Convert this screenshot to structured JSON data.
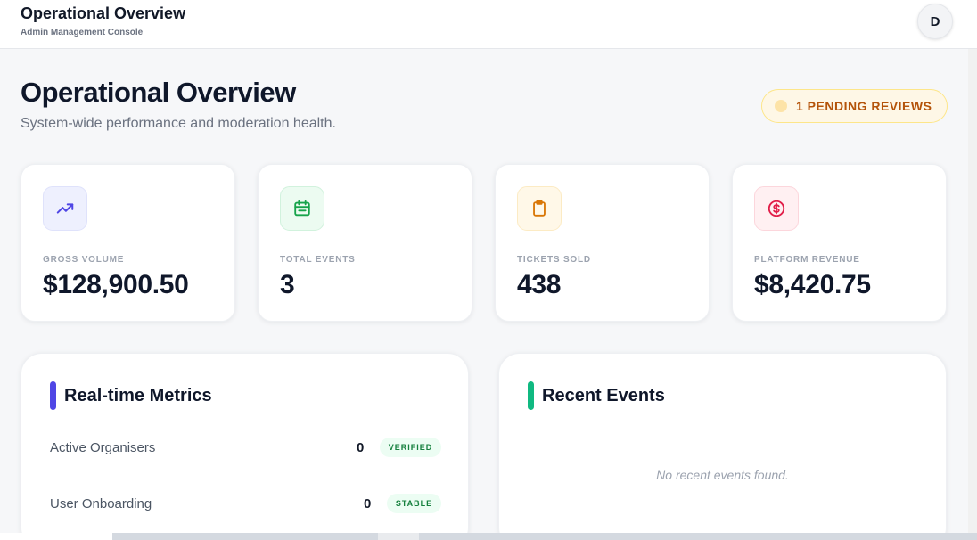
{
  "header": {
    "title": "Operational Overview",
    "subtitle": "Admin Management Console",
    "avatar_initial": "D"
  },
  "page": {
    "title": "Operational Overview",
    "subtitle": "System-wide performance and moderation health.",
    "pending_badge": "1 PENDING REVIEWS"
  },
  "stats": [
    {
      "label": "GROSS VOLUME",
      "value": "$128,900.50",
      "icon": "trending-up-icon",
      "color": "#4f46e5"
    },
    {
      "label": "TOTAL EVENTS",
      "value": "3",
      "icon": "calendar-icon",
      "color": "#16a34a"
    },
    {
      "label": "TICKETS SOLD",
      "value": "438",
      "icon": "clipboard-icon",
      "color": "#d97706"
    },
    {
      "label": "PLATFORM REVENUE",
      "value": "$8,420.75",
      "icon": "dollar-circle-icon",
      "color": "#e11d48"
    }
  ],
  "realtime": {
    "title": "Real-time Metrics",
    "accent": "#4f46e5",
    "rows": [
      {
        "label": "Active Organisers",
        "value": "0",
        "badge": "VERIFIED"
      },
      {
        "label": "User Onboarding",
        "value": "0",
        "badge": "STABLE"
      }
    ]
  },
  "recent": {
    "title": "Recent Events",
    "accent": "#10b981",
    "empty": "No recent events found."
  }
}
